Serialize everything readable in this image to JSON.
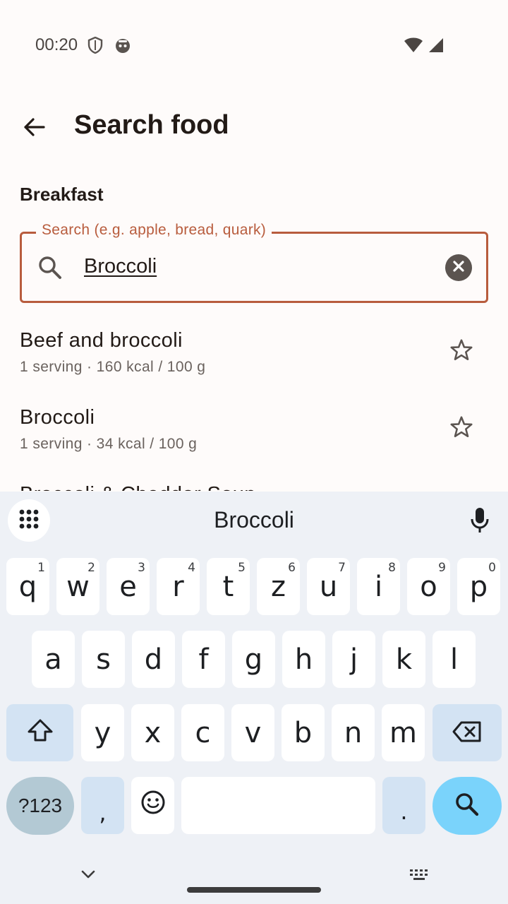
{
  "status_bar": {
    "time": "00:20"
  },
  "app_bar": {
    "title": "Search food"
  },
  "section_label": "Breakfast",
  "search": {
    "label": "Search (e.g. apple, bread, quark)",
    "value": "Broccoli"
  },
  "results": [
    {
      "name": "Beef and broccoli",
      "subtitle": "1 serving · 160 kcal / 100 g"
    },
    {
      "name": "Broccoli",
      "subtitle": "1 serving · 34 kcal / 100 g"
    },
    {
      "name": "Broccoli & Cheddar Soup",
      "subtitle": ""
    }
  ],
  "keyboard": {
    "suggestion": "Broccoli",
    "row1": [
      {
        "key": "q",
        "num": "1"
      },
      {
        "key": "w",
        "num": "2"
      },
      {
        "key": "e",
        "num": "3"
      },
      {
        "key": "r",
        "num": "4"
      },
      {
        "key": "t",
        "num": "5"
      },
      {
        "key": "z",
        "num": "6"
      },
      {
        "key": "u",
        "num": "7"
      },
      {
        "key": "i",
        "num": "8"
      },
      {
        "key": "o",
        "num": "9"
      },
      {
        "key": "p",
        "num": "0"
      }
    ],
    "row2": [
      "a",
      "s",
      "d",
      "f",
      "g",
      "h",
      "j",
      "k",
      "l"
    ],
    "row3": [
      "y",
      "x",
      "c",
      "v",
      "b",
      "n",
      "m"
    ],
    "num_mode_label": "?123",
    "comma": ",",
    "period": ".",
    "accent_color": "#7ad3fb"
  },
  "colors": {
    "primary": "#b85c3d",
    "background": "#fefbfa"
  }
}
